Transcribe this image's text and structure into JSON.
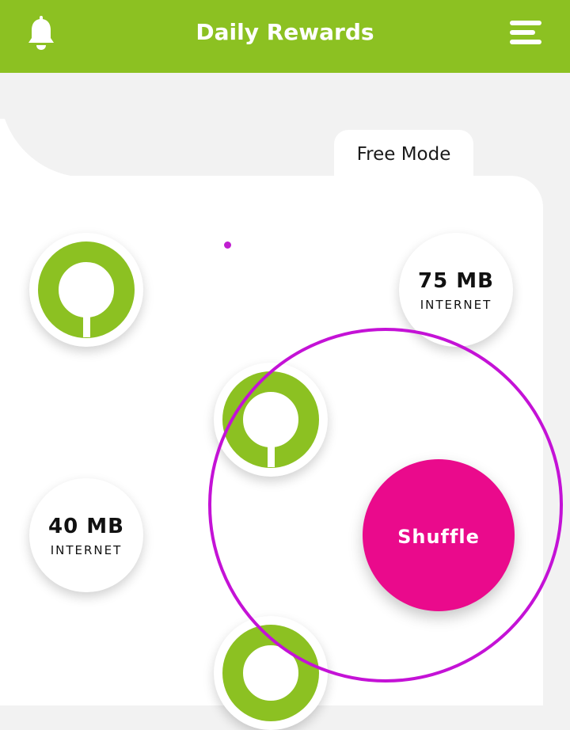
{
  "header": {
    "title": "Daily Rewards",
    "bell_icon": "bell-icon",
    "menu_icon": "menu-icon"
  },
  "mode_tab": {
    "label": "Free Mode"
  },
  "rewards": [
    {
      "amount": "75 MB",
      "unit": "INTERNET"
    },
    {
      "amount": "40 MB",
      "unit": "INTERNET"
    }
  ],
  "shuffle": {
    "label": "Shuffle"
  },
  "colors": {
    "header": "#8cc122",
    "token_ring": "#8cc122",
    "shuffle_button": "#ea0a8c",
    "highlight_ring": "#c412d6"
  }
}
